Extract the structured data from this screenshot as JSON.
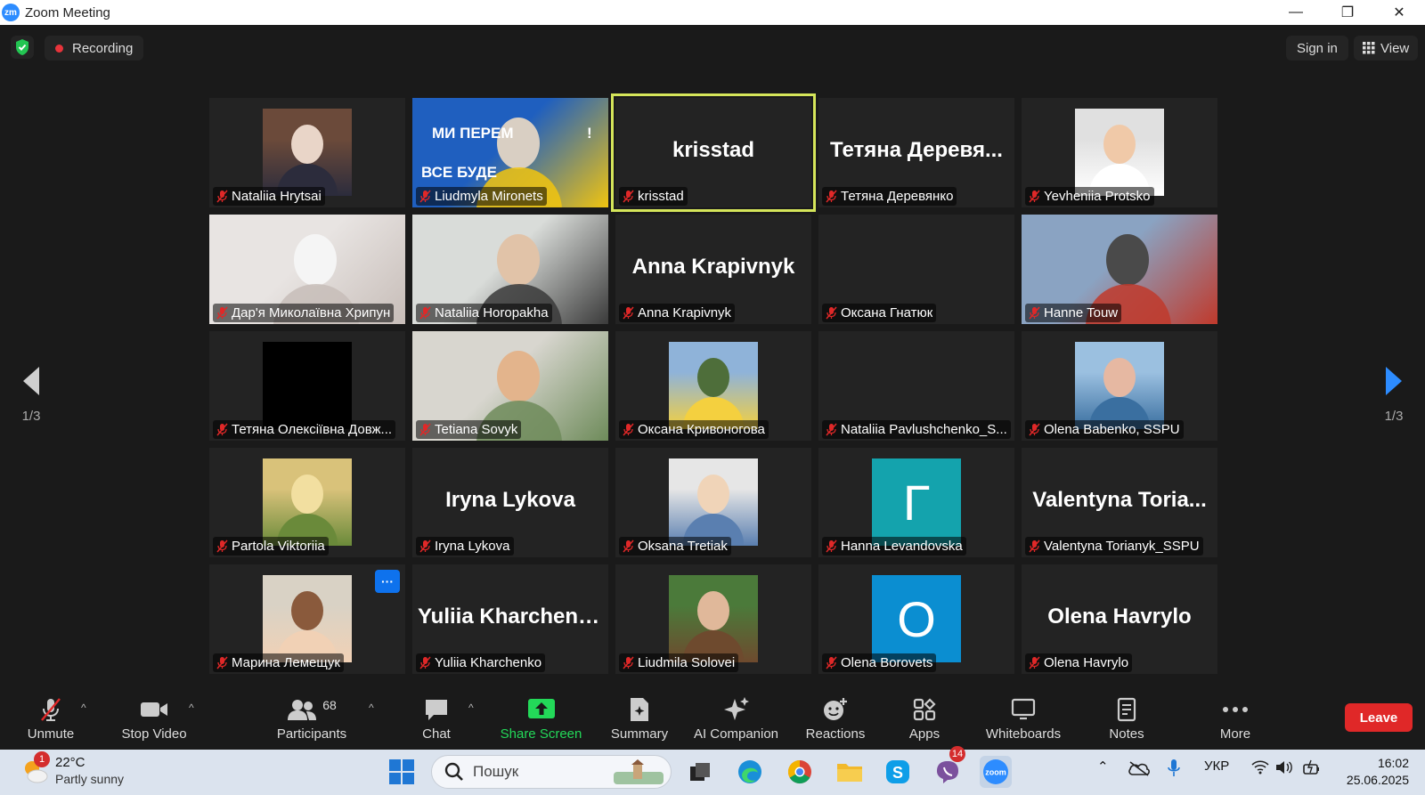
{
  "window": {
    "logo_text": "zm",
    "title": "Zoom Meeting",
    "controls": {
      "minimize": "—",
      "restore": "❐",
      "close": "✕"
    }
  },
  "topbar": {
    "recording_label": "Recording",
    "sign_in_label": "Sign in",
    "view_label": "View"
  },
  "grid": {
    "tiles": [
      {
        "name": "Nataliia Hrytsai",
        "type": "avatar-photo",
        "colors": [
          "#6b4a3a",
          "#e9d5c8",
          "#2c2c3c"
        ]
      },
      {
        "name": "Liudmyla Mironets",
        "type": "full-video",
        "banner_line1": "МИ ПЕРЕМ",
        "banner_line2": "ВСЕ БУДЕ",
        "banner_mark": "!",
        "colors": [
          "#1f5fbf",
          "#f1c40f",
          "#d9cfc3"
        ]
      },
      {
        "name": "krisstad",
        "type": "name-only",
        "big": "krisstad",
        "active": true
      },
      {
        "name": "Тетяна Деревянко",
        "type": "name-only",
        "big": "Тетяна Деревя..."
      },
      {
        "name": "Yevheniia Protsko",
        "type": "avatar-photo",
        "colors": [
          "#e0e0e0",
          "#f0c9a8",
          "#ffffff"
        ]
      },
      {
        "name": "Дар'я Миколаївна Хрипун",
        "type": "full-video",
        "colors": [
          "#e8e4e2",
          "#c7bdb8",
          "#f5f5f5"
        ]
      },
      {
        "name": "Nataliia Horopakha",
        "type": "full-video",
        "colors": [
          "#d9dcd9",
          "#3a3a3a",
          "#e1c3a8"
        ]
      },
      {
        "name": "Anna Krapivnyk",
        "type": "name-only",
        "big": "Anna Krapivnyk"
      },
      {
        "name": "Оксана Гнатюк",
        "type": "empty"
      },
      {
        "name": "Hanne Touw",
        "type": "full-video",
        "colors": [
          "#8aa3c2",
          "#c0392b",
          "#4a4a4a"
        ]
      },
      {
        "name": "Тетяна Олексіївна Довж...",
        "type": "avatar-black"
      },
      {
        "name": "Tetiana Sovyk",
        "type": "full-video",
        "colors": [
          "#d8d6cf",
          "#6e8b5a",
          "#e3b48c"
        ]
      },
      {
        "name": "Оксана Кривоногова",
        "type": "avatar-photo",
        "colors": [
          "#8fb3d9",
          "#4e6e3a",
          "#f4d03f"
        ]
      },
      {
        "name": "Nataliia Pavlushchenko_S...",
        "type": "empty"
      },
      {
        "name": "Olena Babenko, SSPU",
        "type": "avatar-photo",
        "colors": [
          "#9bc0e0",
          "#e6b8a2",
          "#3a6fa0"
        ]
      },
      {
        "name": "Partola Viktoriia",
        "type": "avatar-photo",
        "colors": [
          "#d9c27a",
          "#f2dfa0",
          "#6a8a3a"
        ]
      },
      {
        "name": "Iryna Lykova",
        "type": "name-only",
        "big": "Iryna Lykova"
      },
      {
        "name": "Oksana Tretiak",
        "type": "avatar-photo",
        "colors": [
          "#e6e6e6",
          "#f0d4b8",
          "#5a7fb0"
        ]
      },
      {
        "name": "Hanna Levandovska",
        "type": "avatar-letter",
        "letter": "Г",
        "color": "#14a3ad"
      },
      {
        "name": "Valentyna Torianyk_SSPU",
        "type": "name-only",
        "big": "Valentyna  Toria..."
      },
      {
        "name": "Марина Лемещук",
        "type": "avatar-photo",
        "dots": "···",
        "colors": [
          "#d9d2c5",
          "#8a5a3c",
          "#f1d1b5"
        ]
      },
      {
        "name": "Yuliia Kharchenko",
        "type": "name-only",
        "big": "Yuliia Kharchenko"
      },
      {
        "name": "Liudmila Solovei",
        "type": "avatar-photo",
        "colors": [
          "#4b7a3a",
          "#e0b89a",
          "#6e4a2e"
        ]
      },
      {
        "name": "Olena Borovets",
        "type": "avatar-letter",
        "letter": "O",
        "color": "#0b8ed1"
      },
      {
        "name": "Olena Havrylo",
        "type": "name-only",
        "big": "Olena Havrylo"
      }
    ]
  },
  "pager": {
    "left": "1/3",
    "right": "1/3"
  },
  "toolbar": {
    "unmute": "Unmute",
    "stop_video": "Stop Video",
    "participants": "Participants",
    "participants_count": "68",
    "chat": "Chat",
    "share_screen": "Share Screen",
    "summary": "Summary",
    "ai_companion": "AI Companion",
    "reactions": "Reactions",
    "apps": "Apps",
    "whiteboards": "Whiteboards",
    "notes": "Notes",
    "more": "More",
    "leave": "Leave"
  },
  "taskbar": {
    "weather_temp": "22°C",
    "weather_cond": "Partly sunny",
    "weather_badge": "1",
    "search_placeholder": "Пошук",
    "viber_badge": "14",
    "language": "УКР",
    "time": "16:02",
    "date": "25.06.2025"
  },
  "colors": {
    "accent_blue": "#0e72ed",
    "active_speaker": "#d5e55a",
    "mic_off_red": "#e02828",
    "share_green": "#23d959",
    "leave_red": "#e02828"
  }
}
